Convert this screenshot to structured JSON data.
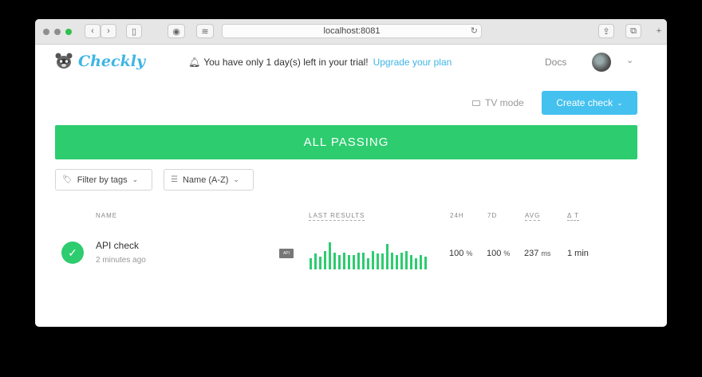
{
  "browser": {
    "address": "localhost:8081"
  },
  "header": {
    "logo_text": "Checkly",
    "trial_message": "You have only 1 day(s) left in your trial!",
    "upgrade_link": "Upgrade your plan",
    "docs": "Docs"
  },
  "toolbar": {
    "tv_mode": "TV mode",
    "create_check": "Create check"
  },
  "banner": {
    "text": "ALL PASSING"
  },
  "filters": {
    "tags": "Filter by tags",
    "sort": "Name (A-Z)"
  },
  "columns": {
    "name": "NAME",
    "last_results": "LAST RESULTS",
    "h24": "24H",
    "d7": "7D",
    "avg": "AVG",
    "dt": "Δ T"
  },
  "checks": [
    {
      "name": "API check",
      "time": "2 minutes ago",
      "type": "API",
      "last_results": [
        8,
        11,
        9,
        13,
        19,
        12,
        10,
        12,
        10,
        10,
        12,
        12,
        8,
        13,
        11,
        11,
        18,
        12,
        10,
        12,
        13,
        10,
        8,
        10,
        9
      ],
      "h24_value": "100",
      "h24_unit": "%",
      "d7_value": "100",
      "d7_unit": "%",
      "avg_value": "237",
      "avg_unit": "ms",
      "dt": "1 min"
    }
  ],
  "colors": {
    "accent": "#3fb5e5",
    "passing": "#2dcc6f",
    "button": "#45c1ef"
  }
}
